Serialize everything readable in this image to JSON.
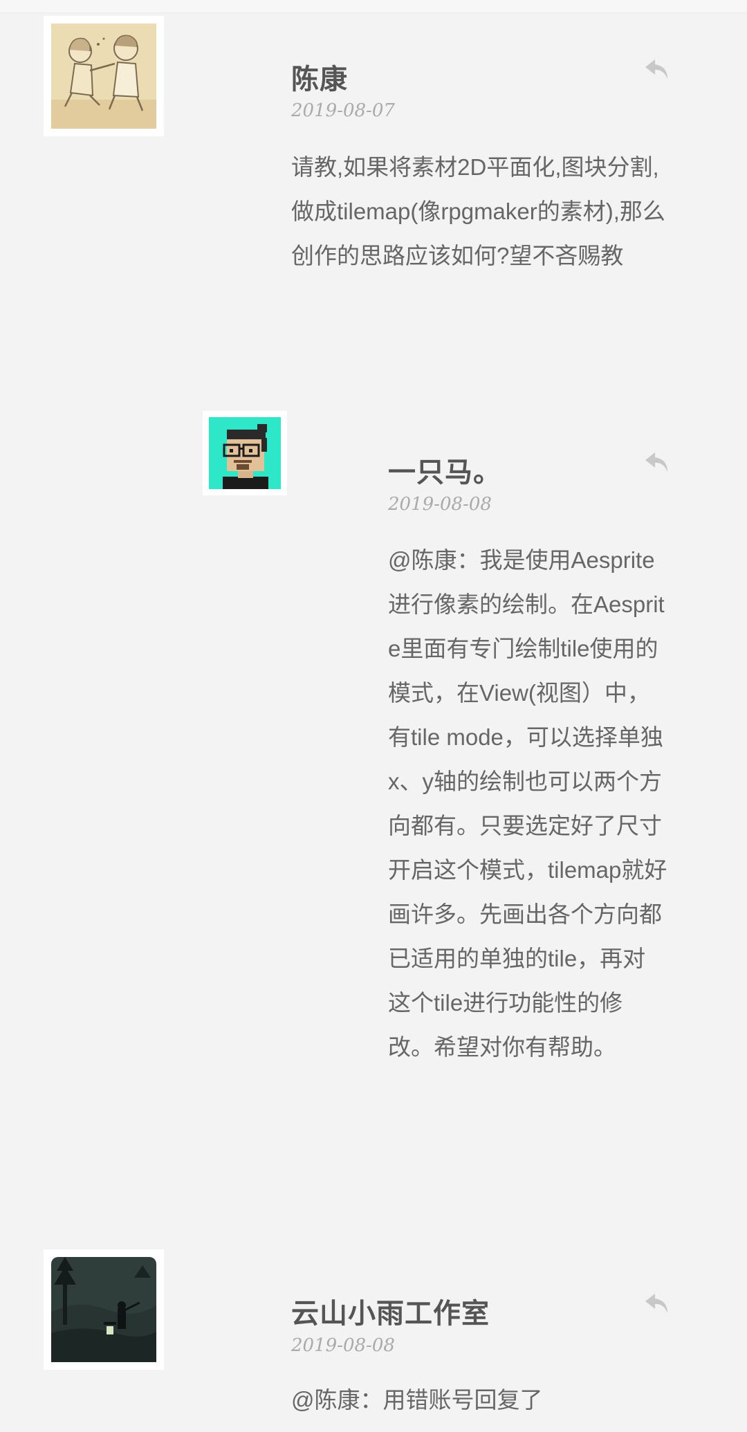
{
  "comments": [
    {
      "author": "陈康",
      "date": "2019-08-07",
      "text": "请教,如果将素材2D平面化,图块分割,做成tilemap(像rpgmaker的素材),那么创作的思路应该如何?望不吝赐教",
      "avatar": "sketch-couple-avatar"
    },
    {
      "author": "一只马。",
      "date": "2019-08-08",
      "text": "@陈康：我是使用Aesprite进行像素的绘制。在Aesprite里面有专门绘制tile使用的模式，在View(视图）中，有tile mode，可以选择单独x、y轴的绘制也可以两个方向都有。只要选定好了尺寸开启这个模式，tilemap就好画许多。先画出各个方向都已适用的单独的tile，再对这个tile进行功能性的修改。希望对你有帮助。",
      "avatar": "pixel-man-avatar"
    },
    {
      "author": "云山小雨工作室",
      "date": "2019-08-08",
      "text": "@陈康：用错账号回复了",
      "avatar": "dark-forest-avatar"
    }
  ],
  "icons": {
    "reply": "reply-icon"
  },
  "colors": {
    "background": "#f3f3f3",
    "author": "#555555",
    "date": "#aaaaaa",
    "text": "#666666",
    "icon": "#c8c8c8",
    "avatar_teal": "#2ee6c8"
  }
}
